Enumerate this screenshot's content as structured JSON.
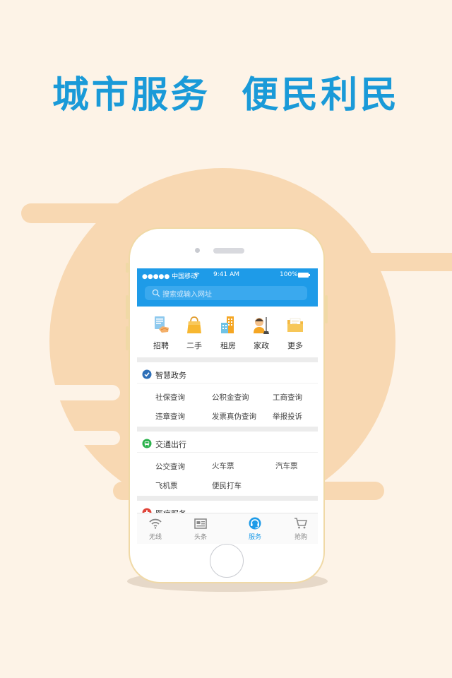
{
  "headline": "城市服务  便民利民",
  "status_bar": {
    "carrier": "●●●●● 中国移动",
    "time": "9:41 AM",
    "battery": "100%"
  },
  "search": {
    "placeholder": "搜索或输入网址",
    "icon": "search-icon"
  },
  "quick_actions": [
    {
      "label": "招聘",
      "icon": "recruit-icon"
    },
    {
      "label": "二手",
      "icon": "shopping-bag-icon"
    },
    {
      "label": "租房",
      "icon": "building-icon"
    },
    {
      "label": "家政",
      "icon": "housekeeping-icon"
    },
    {
      "label": "更多",
      "icon": "folder-icon"
    }
  ],
  "sections": [
    {
      "title": "智慧政务",
      "icon": "check-badge-icon",
      "links": [
        "社保查询",
        "公积金查询",
        "工商查询",
        "违章查询",
        "发票真伪查询",
        "举报投诉"
      ]
    },
    {
      "title": "交通出行",
      "icon": "bus-icon",
      "links": [
        "公交查询",
        "火车票",
        "汽车票",
        "飞机票",
        "便民打车"
      ]
    },
    {
      "title": "医疗服务",
      "icon": "medical-icon",
      "links": []
    }
  ],
  "tabs": [
    {
      "label": "无线",
      "icon": "wifi-icon",
      "active": false
    },
    {
      "label": "头条",
      "icon": "news-icon",
      "active": false
    },
    {
      "label": "服务",
      "icon": "headset-icon",
      "active": true
    },
    {
      "label": "抢购",
      "icon": "cart-icon",
      "active": false
    }
  ],
  "colors": {
    "accent": "#1e9be8",
    "headline": "#1a9ad8",
    "background": "#fdf3e7",
    "decor": "#f8d8b2",
    "phone_frame": "#f0d9a6"
  }
}
